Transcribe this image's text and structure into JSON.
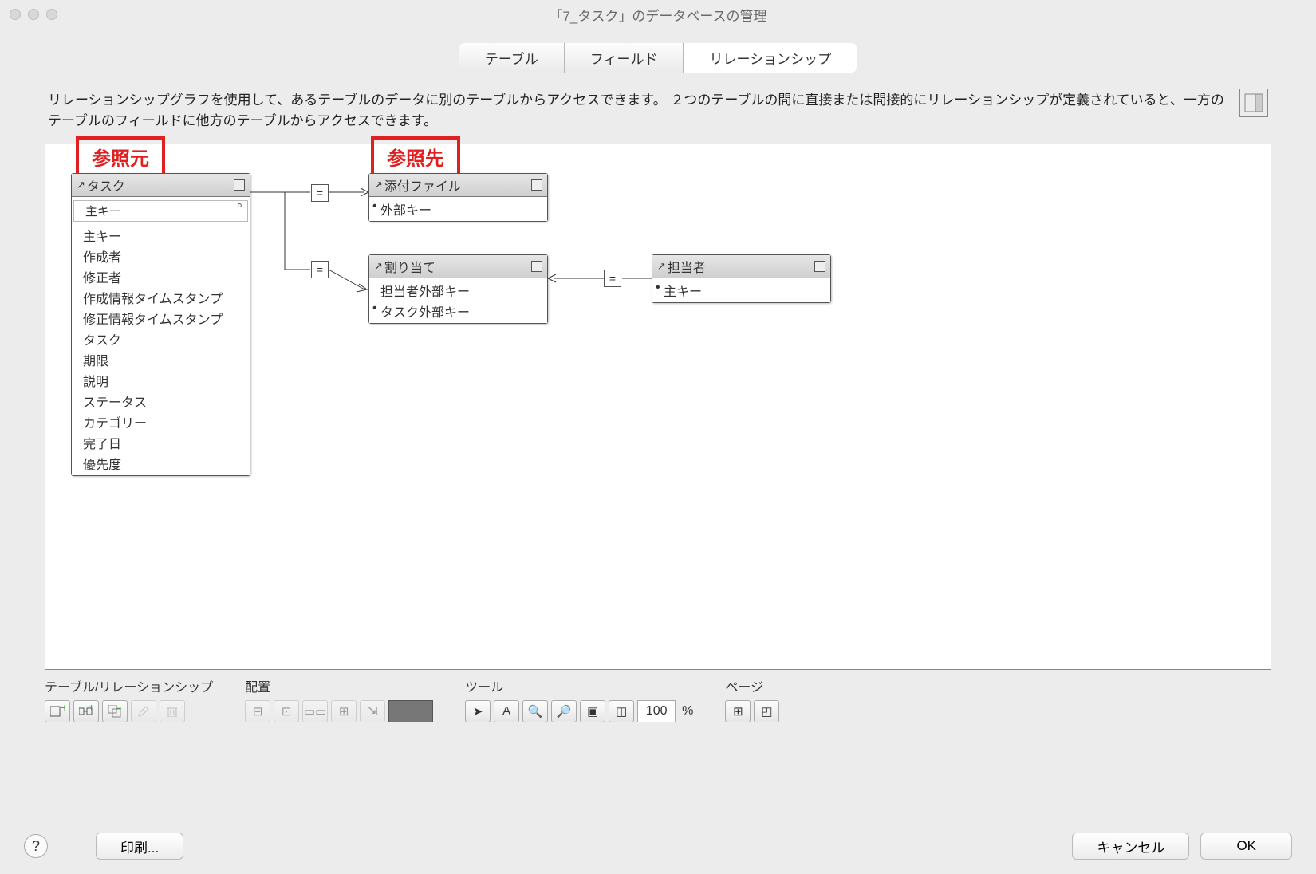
{
  "window": {
    "title": "「7_タスク」のデータベースの管理"
  },
  "tabs": {
    "t1": "テーブル",
    "t2": "フィールド",
    "t3": "リレーションシップ"
  },
  "description": "リレーションシップグラフを使用して、あるテーブルのデータに別のテーブルからアクセスできます。 ２つのテーブルの間に直接または間接的にリレーションシップが定義されていると、一方のテーブルのフィールドに他方のテーブルからアクセスできます。",
  "annotations": {
    "source": "参照元",
    "target": "参照先"
  },
  "tables": {
    "task": {
      "name": "タスク",
      "pk": "主キー",
      "fields": [
        "主キー",
        "作成者",
        "修正者",
        "作成情報タイムスタンプ",
        "修正情報タイムスタンプ",
        "タスク",
        "期限",
        "説明",
        "ステータス",
        "カテゴリー",
        "完了日",
        "優先度"
      ]
    },
    "attachment": {
      "name": "添付ファイル",
      "fields": [
        "外部キー"
      ]
    },
    "assignment": {
      "name": "割り当て",
      "fields": [
        "担当者外部キー",
        "タスク外部キー"
      ]
    },
    "assignee": {
      "name": "担当者",
      "fields": [
        "主キー"
      ]
    }
  },
  "operators": {
    "op1": "=",
    "op2": "=",
    "op3": "="
  },
  "toolbar": {
    "group_tables": "テーブル/リレーションシップ",
    "group_arrange": "配置",
    "group_tool": "ツール",
    "group_page": "ページ",
    "zoom": "100",
    "pct": "%"
  },
  "footer": {
    "print": "印刷...",
    "cancel": "キャンセル",
    "ok": "OK",
    "help": "?"
  }
}
